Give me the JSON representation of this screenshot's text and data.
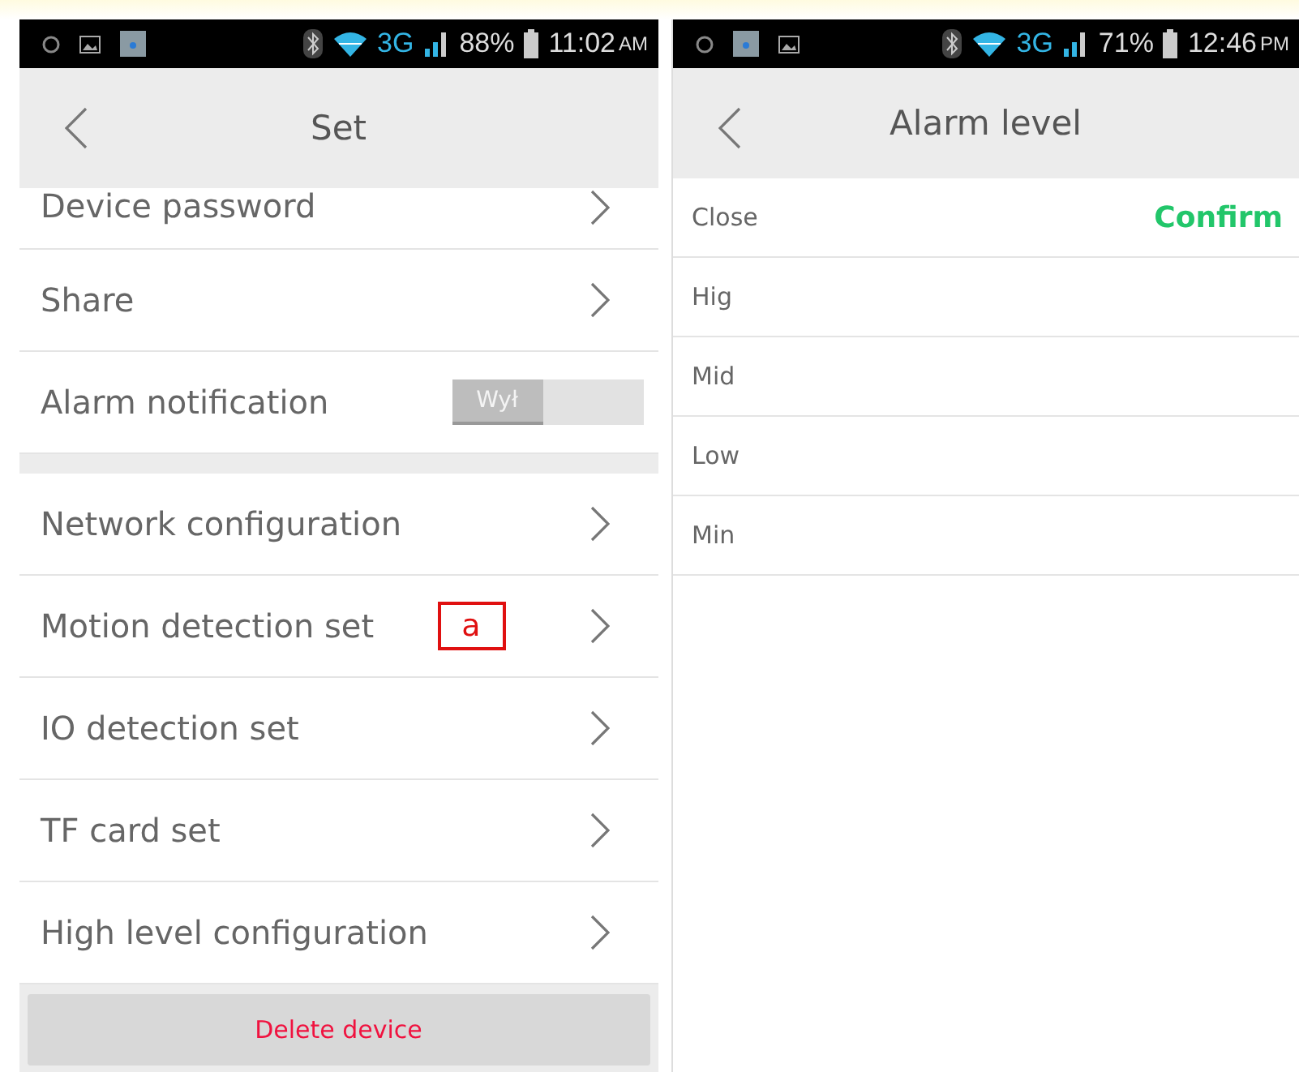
{
  "screens": [
    {
      "status_bar": {
        "network": "3G",
        "battery": "88%",
        "time": "11:02",
        "period": "AM",
        "notifications": [
          {
            "kind": "alarm"
          },
          {
            "kind": "image"
          },
          {
            "kind": "app"
          }
        ]
      },
      "header": {
        "title": "Set"
      },
      "rows": [
        {
          "kind": "link",
          "label": "Device password",
          "partial": true
        },
        {
          "kind": "link",
          "label": "Share"
        },
        {
          "kind": "toggle",
          "label": "Alarm notification",
          "toggle_label": "Wył",
          "on": false
        },
        {
          "kind": "gap"
        },
        {
          "kind": "link",
          "label": "Network configuration"
        },
        {
          "kind": "link",
          "label": "Motion detection set",
          "annotation": "a"
        },
        {
          "kind": "link",
          "label": "IO detection set"
        },
        {
          "kind": "link",
          "label": "TF card set"
        },
        {
          "kind": "link",
          "label": "High level configuration"
        }
      ],
      "footer_button": "Delete device"
    },
    {
      "status_bar": {
        "network": "3G",
        "battery": "71%",
        "time": "12:46",
        "period": "PM",
        "notifications": [
          {
            "kind": "alarm"
          },
          {
            "kind": "app"
          },
          {
            "kind": "image"
          }
        ]
      },
      "header": {
        "title": "Alarm level"
      },
      "action_bar": {
        "left": "Close",
        "right": "Confirm"
      },
      "options": [
        {
          "label": "Hig"
        },
        {
          "label": "Mid"
        },
        {
          "label": "Low"
        },
        {
          "label": "Min"
        }
      ]
    }
  ]
}
